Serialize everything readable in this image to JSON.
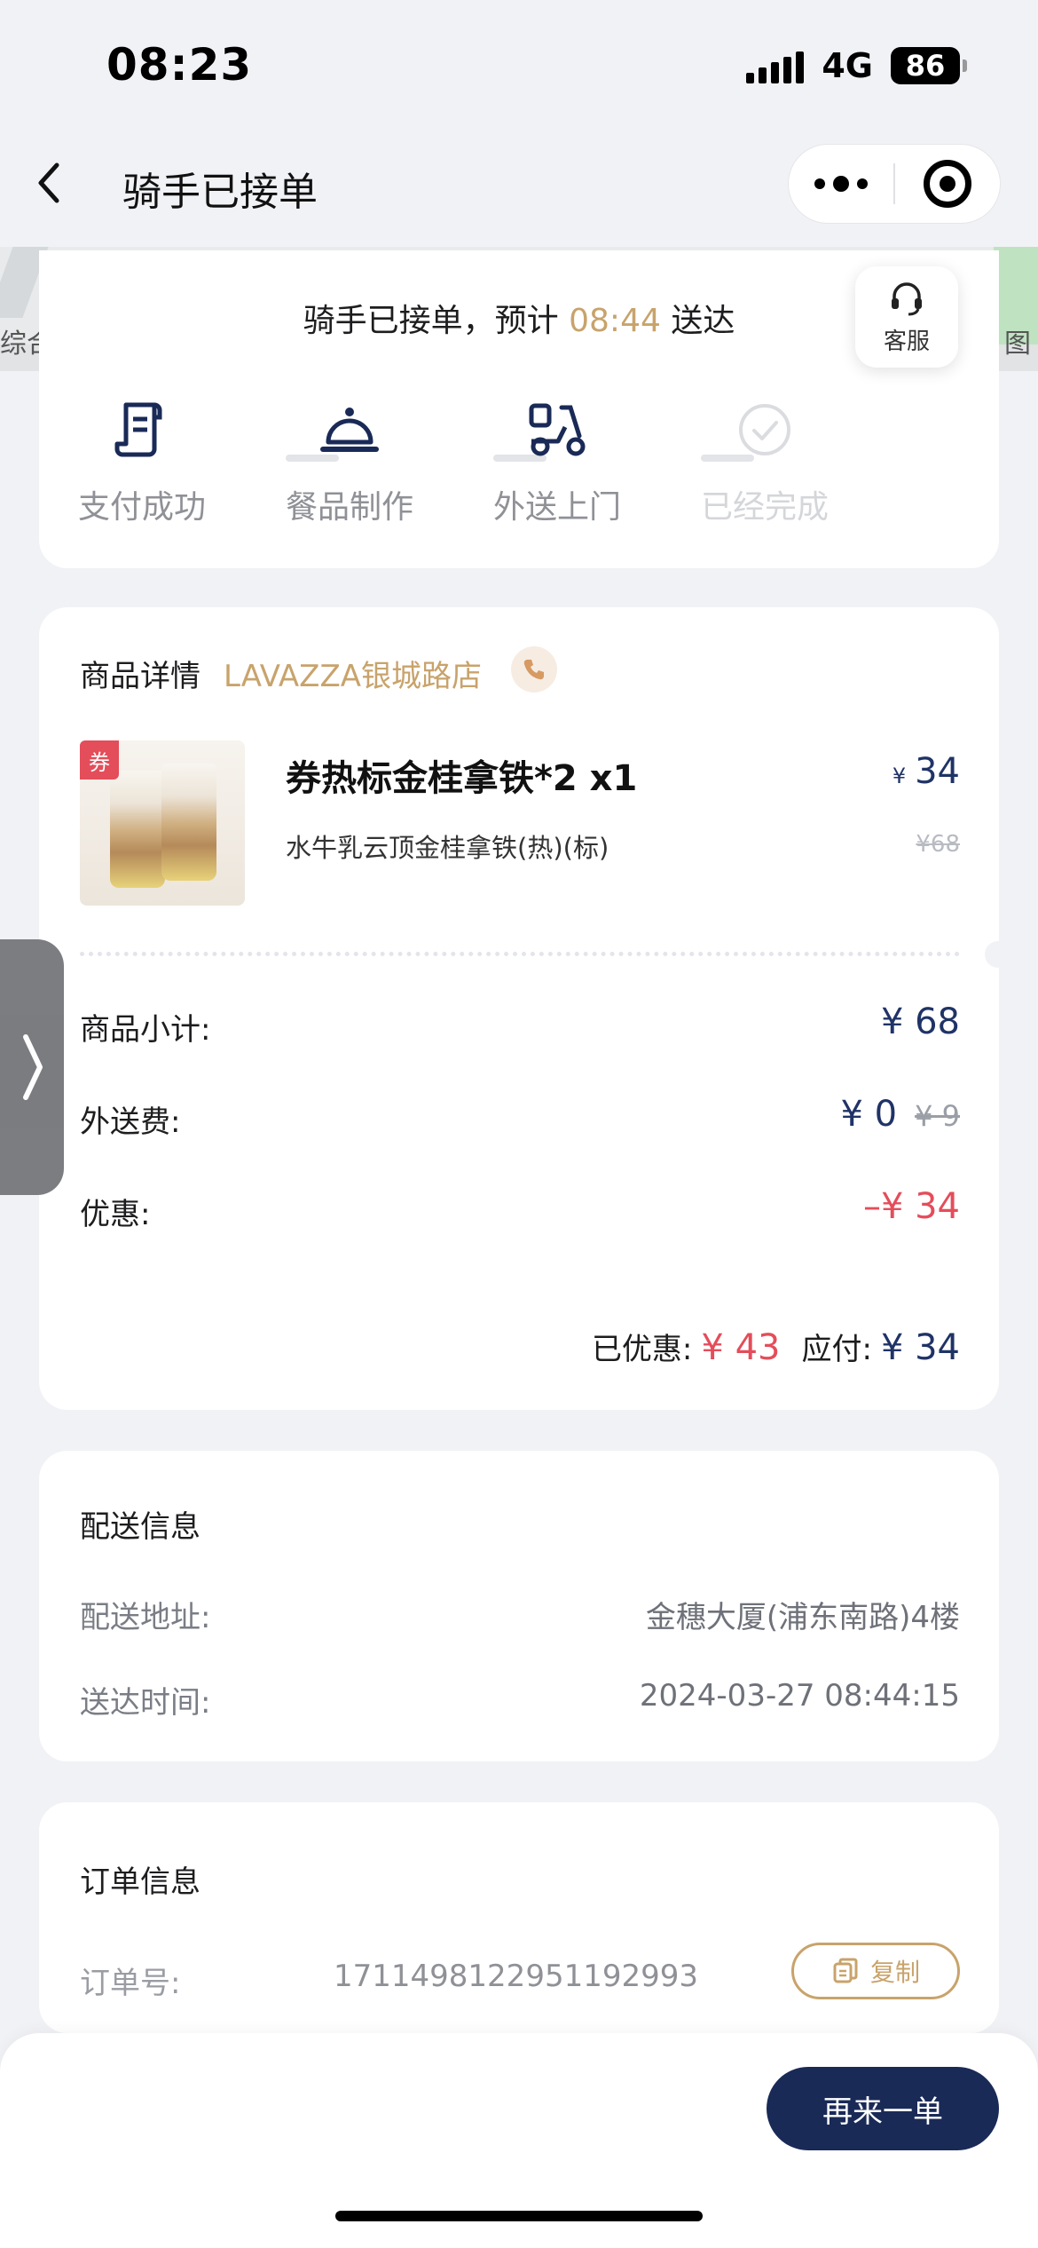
{
  "status_bar": {
    "time": "08:23",
    "network": "4G",
    "battery": "86"
  },
  "nav": {
    "title": "骑手已接单"
  },
  "map": {
    "left_label": "综合",
    "right_label": "图"
  },
  "order_status": {
    "eta_prefix": "骑手已接单，预计",
    "eta_time": "08:44",
    "eta_suffix": "送达",
    "customer_service": "客服",
    "steps": [
      {
        "label": "支付成功",
        "icon": "receipt-icon",
        "done": true
      },
      {
        "label": "餐品制作",
        "icon": "cloche-icon",
        "done": true
      },
      {
        "label": "外送上门",
        "icon": "scooter-icon",
        "done": true
      },
      {
        "label": "已经完成",
        "icon": "check-circle-icon",
        "done": false
      }
    ]
  },
  "goods": {
    "title": "商品详情",
    "store": "LAVAZZA银城路店",
    "coupon_tag": "券",
    "item": {
      "name": "券热标金桂拿铁*2 x1",
      "currency": "¥",
      "price": "34",
      "spec": "水牛乳云顶金桂拿铁(热)(标)",
      "original_price": "¥68"
    },
    "subtotal_label": "商品小计:",
    "subtotal_value": "¥ 68",
    "delivery_label": "外送费:",
    "delivery_value": "¥ 0",
    "delivery_original": "¥ 9",
    "discount_label": "优惠:",
    "discount_value": "–¥ 34",
    "saved_label": "已优惠:",
    "saved_value": "¥ 43",
    "payable_label": "应付:",
    "payable_value": "¥ 34"
  },
  "delivery": {
    "title": "配送信息",
    "address_label": "配送地址:",
    "address": "金穗大厦(浦东南路)4楼",
    "time_label": "送达时间:",
    "time": "2024-03-27 08:44:15"
  },
  "order": {
    "title": "订单信息",
    "number_label": "订单号:",
    "number": "1711498122951192993",
    "copy_label": "复制"
  },
  "footer": {
    "reorder_label": "再来一单"
  },
  "colors": {
    "gold": "#c8a36b",
    "navy": "#1a2a57",
    "red": "#e44d5a"
  }
}
